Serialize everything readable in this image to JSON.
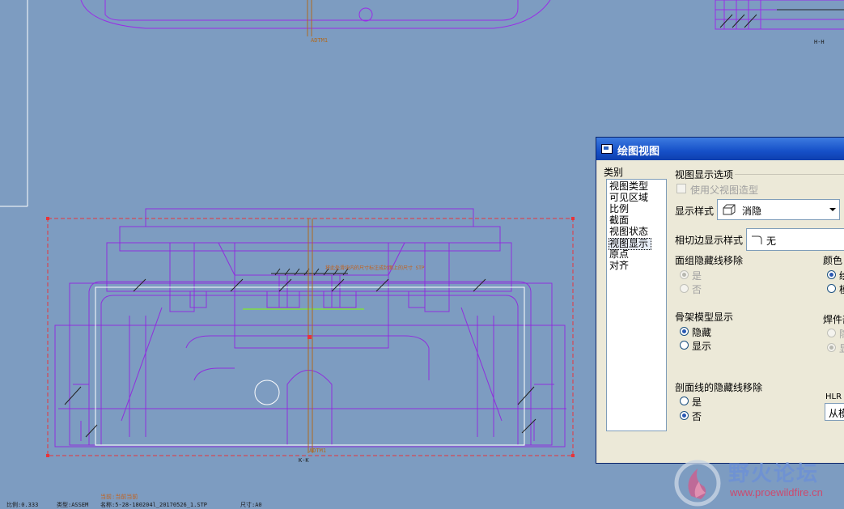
{
  "drawing": {
    "view_label_top": "ADTM1",
    "view_label_bottom": "ADTM1",
    "section_label_main": "K-K",
    "section_label_top_right": "H-H",
    "annotation_note": "将此处滑块内的尺寸标注成封面上的尺寸 STP",
    "status": {
      "scale": "比例:0.333",
      "type": "类型:ASSEM",
      "name": "名称:5-28-180204l_20170526_1.STP",
      "size": "尺寸:A0",
      "top_note": "当前:当前当前"
    }
  },
  "dialog": {
    "title": "绘图视图",
    "category_label": "类别",
    "categories": [
      "视图类型",
      "可见区域",
      "比例",
      "截面",
      "视图状态",
      "视图显示",
      "原点",
      "对齐"
    ],
    "selected_category": "视图显示",
    "options_title": "视图显示选项",
    "use_parent_label": "使用父视图造型",
    "display_style_label": "显示样式",
    "display_style_value": "消隐",
    "tangent_label": "相切边显示样式",
    "tangent_value": "无",
    "face_group_label": "面组隐藏线移除",
    "face_group_yes": "是",
    "face_group_no": "否",
    "skeleton_label": "骨架模型显示",
    "skeleton_hide": "隐藏",
    "skeleton_show": "显示",
    "section_hidden_label": "剖面线的隐藏线移除",
    "section_yes": "是",
    "section_no": "否",
    "color_label": "颜色",
    "color_opt1": "绘",
    "color_opt2": "模",
    "weld_label": "焊件剖",
    "weld_opt1": "隐",
    "weld_opt2": "显",
    "hlr_label": "HLR",
    "hlr_value": "从模"
  },
  "watermark": {
    "title": "野火论坛",
    "url": "www.proewildfire.cn"
  },
  "colors": {
    "background": "#7d9cc1",
    "geometry": "#8a2be2",
    "dialog_title": "#1650c8"
  }
}
